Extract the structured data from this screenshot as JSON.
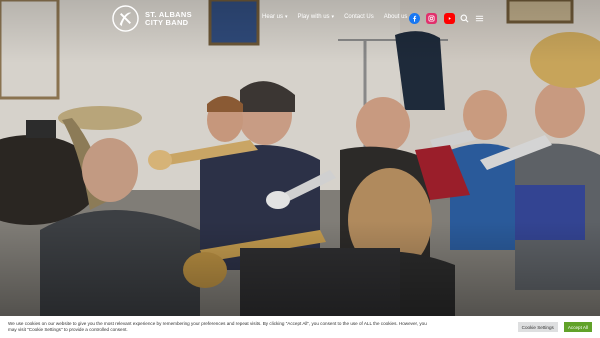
{
  "header": {
    "brand_line1": "ST. ALBANS",
    "brand_line2": "CITY BAND",
    "nav": [
      {
        "label": "Hear us",
        "has_dropdown": true
      },
      {
        "label": "Play with us",
        "has_dropdown": true
      },
      {
        "label": "Contact Us",
        "has_dropdown": false
      },
      {
        "label": "About us",
        "has_dropdown": true
      }
    ],
    "social": [
      "facebook-icon",
      "instagram-icon",
      "youtube-icon"
    ],
    "utility_icons": [
      "search-icon",
      "menu-icon"
    ]
  },
  "hero": {
    "image_alt": "Band members rehearsing with trumpets and brass instruments"
  },
  "cookie": {
    "text": "We use cookies on our website to give you the most relevant experience by remembering your preferences and repeat visits. By clicking “Accept All”, you consent to the use of ALL the cookies. However, you may visit \"Cookie Settings\" to provide a controlled consent.",
    "settings_label": "Cookie Settings",
    "accept_label": "Accept All"
  },
  "colors": {
    "facebook": "#1877f2",
    "instagram": "#e1306c",
    "youtube": "#ff0000",
    "accept": "#61a229"
  }
}
